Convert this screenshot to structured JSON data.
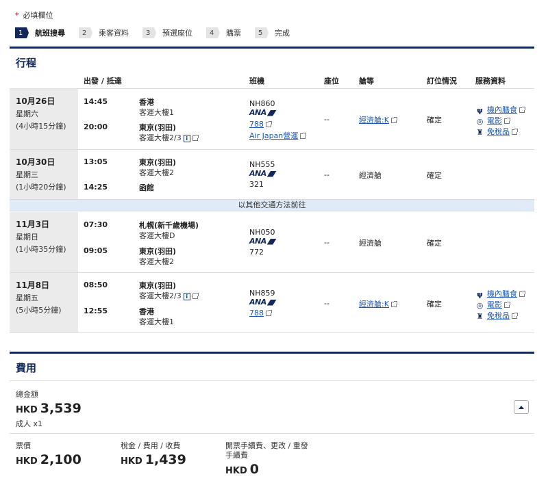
{
  "required_note": {
    "star": "*",
    "text": "必填欄位"
  },
  "steps": [
    {
      "num": "1",
      "label": "航班搜尋"
    },
    {
      "num": "2",
      "label": "乘客資料"
    },
    {
      "num": "3",
      "label": "預選座位"
    },
    {
      "num": "4",
      "label": "購票"
    },
    {
      "num": "5",
      "label": "完成"
    }
  ],
  "itinerary": {
    "title": "行程",
    "headers": {
      "depart_arrive": "出發 / 抵達",
      "flight": "班機",
      "seat": "座位",
      "cabin": "艙等",
      "booking": "訂位情況",
      "services": "服務資料"
    },
    "transfer_note": "以其他交通方法前往",
    "flights": [
      {
        "date": "10月26日",
        "weekday": "星期六",
        "duration": "(4小時15分鐘)",
        "dep_time": "14:45",
        "dep_city": "香港",
        "dep_term": "客運大樓1",
        "arr_time": "20:00",
        "arr_city": "東京(羽田)",
        "arr_term": "客運大樓2/3",
        "flight_no": "NH860",
        "airline_logo": "ANA",
        "aircraft": "788",
        "operator": "Air Japan營運",
        "seat": "--",
        "cabin": "經濟艙:K",
        "status": "確定",
        "services": [
          "機內膳食",
          "電影",
          "免稅品"
        ]
      },
      {
        "date": "10月30日",
        "weekday": "星期三",
        "duration": "(1小時20分鐘)",
        "dep_time": "13:05",
        "dep_city": "東京(羽田)",
        "dep_term": "客運大樓2",
        "arr_time": "14:25",
        "arr_city": "函館",
        "flight_no": "NH555",
        "airline_logo": "ANA",
        "aircraft": "321",
        "seat": "--",
        "cabin": "經濟艙",
        "status": "確定"
      },
      {
        "date": "11月3日",
        "weekday": "星期日",
        "duration": "(1小時35分鐘)",
        "dep_time": "07:30",
        "dep_city": "札幌(新千歲機場)",
        "dep_term": "客運大樓D",
        "arr_time": "09:05",
        "arr_city": "東京(羽田)",
        "arr_term": "客運大樓2",
        "flight_no": "NH050",
        "airline_logo": "ANA",
        "aircraft": "772",
        "seat": "--",
        "cabin": "經濟艙",
        "status": "確定"
      },
      {
        "date": "11月8日",
        "weekday": "星期五",
        "duration": "(5小時5分鐘)",
        "dep_time": "08:50",
        "dep_city": "東京(羽田)",
        "dep_term": "客運大樓2/3",
        "arr_time": "12:55",
        "arr_city": "香港",
        "arr_term": "客運大樓1",
        "flight_no": "NH859",
        "airline_logo": "ANA",
        "aircraft": "788",
        "seat": "--",
        "cabin": "經濟艙:K",
        "status": "確定",
        "services": [
          "機內膳食",
          "電影",
          "免稅品"
        ]
      }
    ]
  },
  "fees": {
    "title": "費用",
    "total_label": "總金額",
    "total_currency": "HKD",
    "total_value": "3,539",
    "pax": "成人 x1",
    "fare_label": "票價",
    "fare_currency": "HKD",
    "fare_value": "2,100",
    "tax_label": "稅金 / 費用 / 收費",
    "tax_currency": "HKD",
    "tax_value": "1,439",
    "handling_label_1": "開票手續費、更改 / 重發",
    "handling_label_2": "手續費",
    "handling_currency": "HKD",
    "handling_value": "0"
  },
  "colors": {
    "brand": "#13285a",
    "link": "#1c58b8",
    "row_date_bg": "#ebebeb",
    "band_bg": "#e1ebf5",
    "required_star": "#cc0000"
  },
  "icons": {
    "meal": "meal-icon",
    "movie": "movie-icon",
    "dutyfree": "duty-free-icon",
    "external": "external-link-icon",
    "info": "info-icon"
  }
}
